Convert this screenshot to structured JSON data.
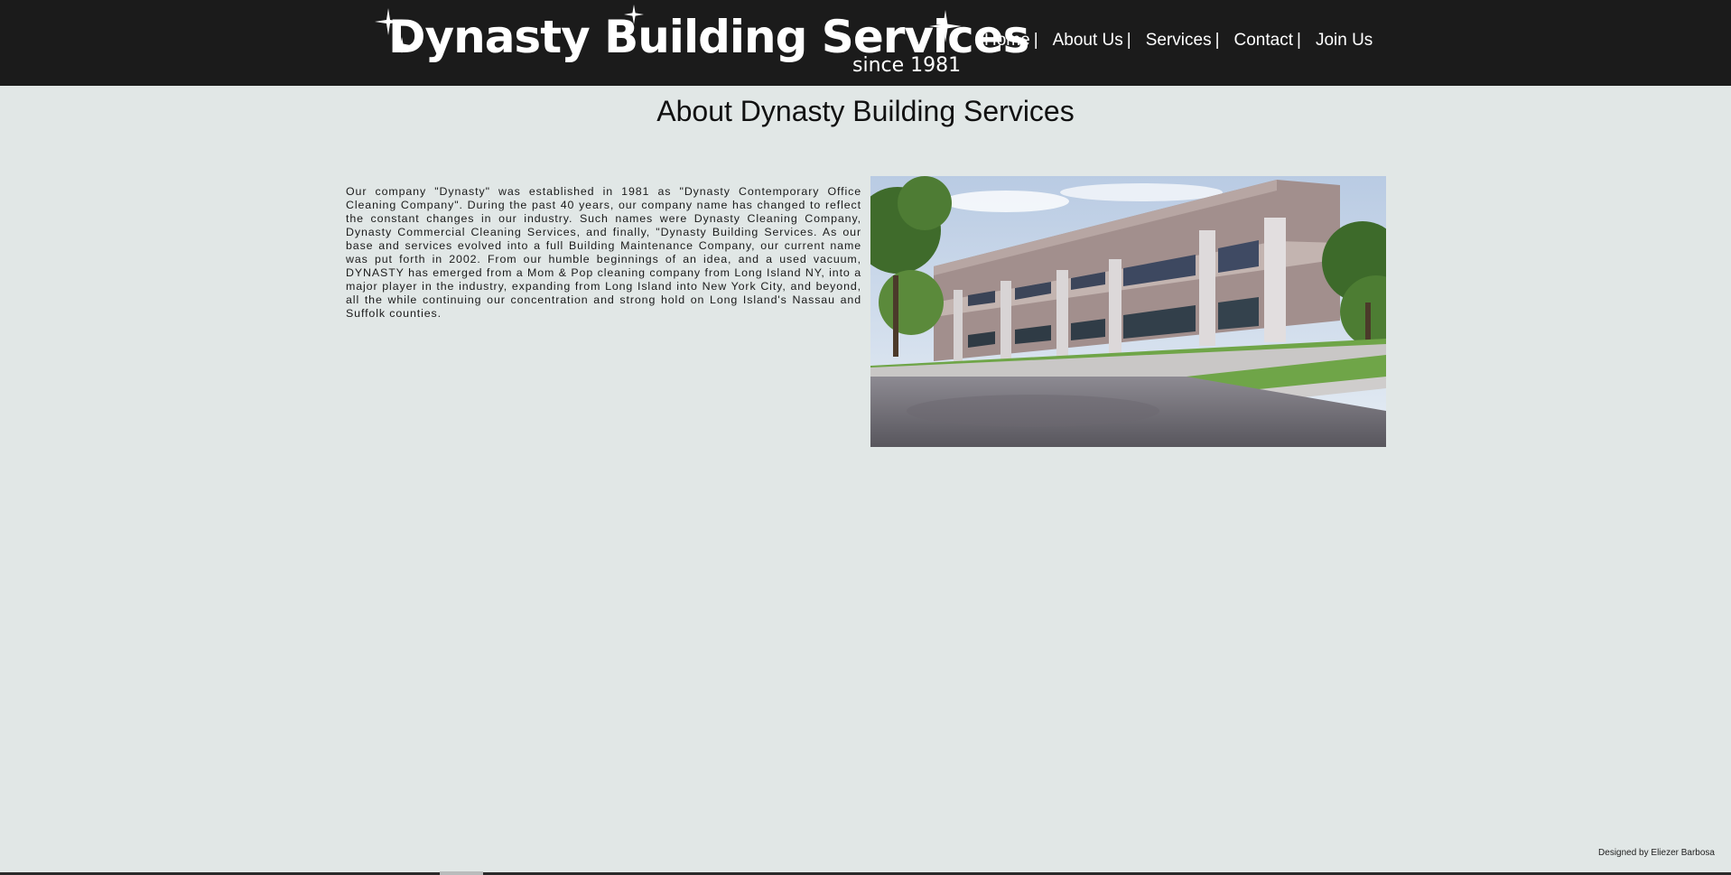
{
  "header": {
    "logo_title": "Dynasty Building Services",
    "logo_subtitle": "since 1981",
    "nav": [
      {
        "label": "Home"
      },
      {
        "label": "About Us"
      },
      {
        "label": "Services"
      },
      {
        "label": "Contact"
      },
      {
        "label": "Join Us"
      }
    ],
    "nav_separator": "|"
  },
  "main": {
    "title": "About Dynasty Building Services",
    "paragraph": "Our company \"Dynasty\" was established in 1981 as \"Dynasty Contemporary Office Cleaning Company\". During the past 40 years, our company name has changed to reflect the constant changes in our industry. Such names were Dynasty Cleaning Company, Dynasty Commercial Cleaning Services, and finally, \"Dynasty Building Services. As our base and services evolved into a full Building Maintenance Company, our current name was put forth in 2002. From our humble beginnings of an idea, and a used vacuum, DYNASTY has emerged from a Mom & Pop cleaning company from Long Island NY, into a major player in the industry, expanding from Long Island into New York City, and beyond, all the while continuing our concentration and strong hold on Long Island's Nassau and Suffolk counties."
  },
  "footer": {
    "credit": "Designed by Eliezer Barbosa"
  },
  "colors": {
    "header_bg": "#1b1b1b",
    "page_bg": "#e1e7e6",
    "nav_text": "#ffffff"
  }
}
